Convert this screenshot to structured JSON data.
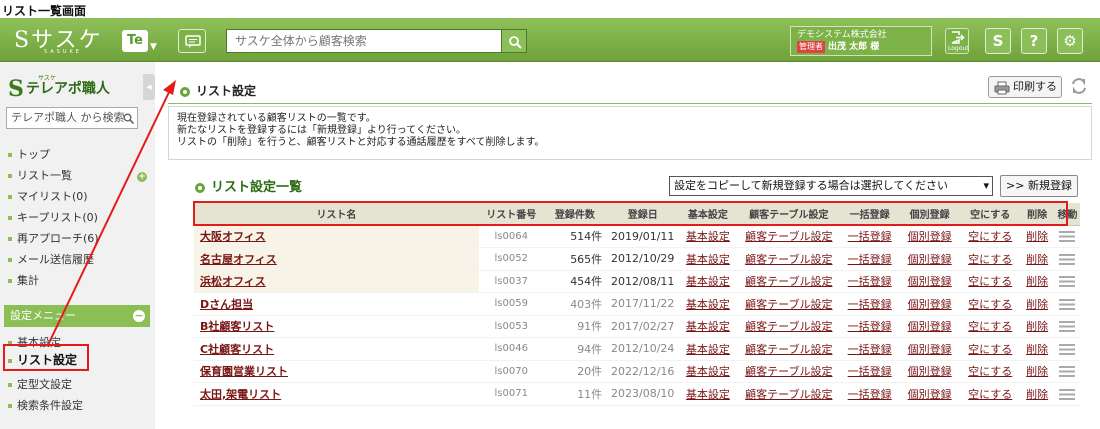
{
  "caption": "リスト一覧画面",
  "topbar": {
    "logo": "Sサスケ",
    "logo_sub": "SASUKE",
    "te_badge": "Te",
    "search_placeholder": "サスケ全体から顧客検索",
    "company": "デモシステム株式会社",
    "role": "管理者",
    "user": "出茂 太郎 様",
    "logout": "Logout",
    "btn_s": "S",
    "btn_help": "?",
    "btn_gear": "⚙"
  },
  "sidebar": {
    "logo_kana": "サスケ",
    "logo_text": "テレアポ職人",
    "search_placeholder": "テレアポ職人 から検索",
    "items": [
      {
        "label": "トップ"
      },
      {
        "label": "リスト一覧"
      },
      {
        "label": "マイリスト(0)"
      },
      {
        "label": "キープリスト(0)"
      },
      {
        "label": "再アプローチ(6)"
      },
      {
        "label": "メール送信履歴"
      },
      {
        "label": "集計"
      }
    ],
    "settings_menu": "設定メニュー",
    "settings_items": [
      {
        "label": "基本設定"
      },
      {
        "label": "リスト設定"
      },
      {
        "label": "定型文設定"
      },
      {
        "label": "検索条件設定"
      }
    ]
  },
  "main": {
    "title": "リスト設定",
    "print_label": "印刷する",
    "description": [
      "現在登録されている顧客リストの一覧です。",
      "新たなリストを登録するには「新規登録」より行ってください。",
      "リストの「削除」を行うと、顧客リストと対応する通話履歴をすべて削除します。"
    ],
    "list_title": "リスト設定一覧",
    "copy_select": "設定をコピーして新規登録する場合は選択してください",
    "new_button": ">> 新規登録",
    "columns": [
      "リスト名",
      "リスト番号",
      "登録件数",
      "登録日",
      "基本設定",
      "顧客テーブル設定",
      "一括登録",
      "個別登録",
      "空にする",
      "削除",
      "移動"
    ],
    "rows": [
      {
        "name": "大阪オフィス",
        "num": "ls0064",
        "count": "514件",
        "date": "2019/01/11",
        "basic": "基本設定",
        "table": "顧客テーブル設定",
        "bulk": "一括登録",
        "single": "個別登録",
        "empty": "空にする",
        "del": "削除"
      },
      {
        "name": "名古屋オフィス",
        "num": "ls0052",
        "count": "565件",
        "date": "2012/10/29",
        "basic": "基本設定",
        "table": "顧客テーブル設定",
        "bulk": "一括登録",
        "single": "個別登録",
        "empty": "空にする",
        "del": "削除"
      },
      {
        "name": "浜松オフィス",
        "num": "ls0037",
        "count": "454件",
        "date": "2012/08/11",
        "basic": "基本設定",
        "table": "顧客テーブル設定",
        "bulk": "一括登録",
        "single": "個別登録",
        "empty": "空にする",
        "del": "削除"
      },
      {
        "name": "Dさん担当",
        "num": "ls0059",
        "count": "403件",
        "date": "2017/11/22",
        "basic": "基本設定",
        "table": "顧客テーブル設定",
        "bulk": "一括登録",
        "single": "個別登録",
        "empty": "空にする",
        "del": "削除"
      },
      {
        "name": "B社顧客リスト",
        "num": "ls0053",
        "count": "91件",
        "date": "2017/02/27",
        "basic": "基本設定",
        "table": "顧客テーブル設定",
        "bulk": "一括登録",
        "single": "個別登録",
        "empty": "空にする",
        "del": "削除"
      },
      {
        "name": "C社顧客リスト",
        "num": "ls0046",
        "count": "94件",
        "date": "2012/10/24",
        "basic": "基本設定",
        "table": "顧客テーブル設定",
        "bulk": "一括登録",
        "single": "個別登録",
        "empty": "空にする",
        "del": "削除"
      },
      {
        "name": "保育園営業リスト",
        "num": "ls0070",
        "count": "20件",
        "date": "2022/12/16",
        "basic": "基本設定",
        "table": "顧客テーブル設定",
        "bulk": "一括登録",
        "single": "個別登録",
        "empty": "空にする",
        "del": "削除"
      },
      {
        "name": "太田,架電リスト",
        "num": "ls0071",
        "count": "11件",
        "date": "2023/08/10",
        "basic": "基本設定",
        "table": "顧客テーブル設定",
        "bulk": "一括登録",
        "single": "個別登録",
        "empty": "空にする",
        "del": "削除"
      }
    ]
  },
  "colors": {
    "brand_green": "#7db248",
    "link_red": "#7a1515",
    "highlight_red": "#e31b1b"
  }
}
